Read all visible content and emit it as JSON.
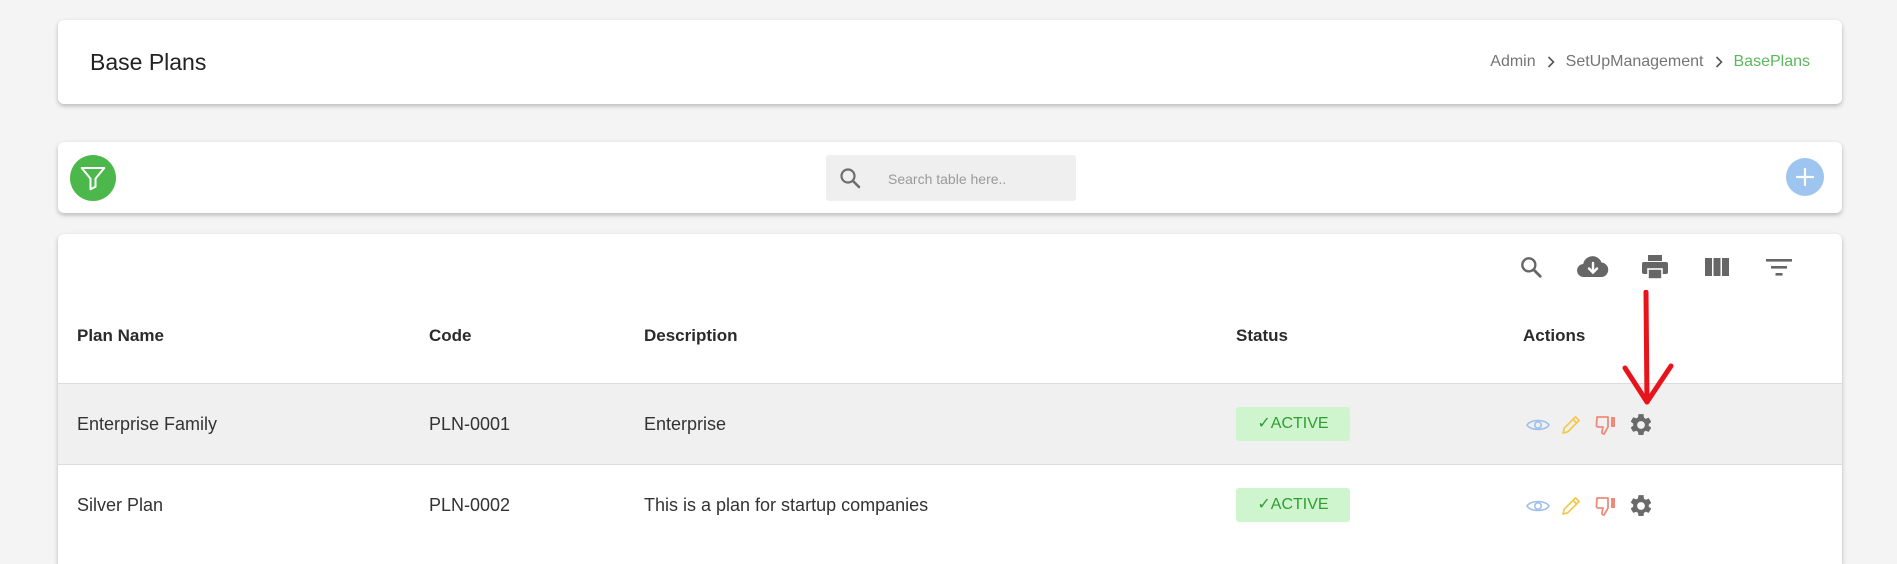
{
  "header": {
    "title": "Base Plans",
    "breadcrumb": [
      "Admin",
      "SetUpManagement",
      "BasePlans"
    ]
  },
  "toolbar": {
    "search_placeholder": "Search table here..",
    "search_value": "",
    "filter_icon": "filter-icon",
    "add_icon": "plus-icon"
  },
  "table_tools": [
    "search-icon",
    "cloud-download-icon",
    "print-icon",
    "view-columns-icon",
    "filter-list-icon"
  ],
  "table": {
    "columns": [
      "Plan Name",
      "Code",
      "Description",
      "Status",
      "Actions"
    ],
    "rows": [
      {
        "plan_name": "Enterprise Family",
        "code": "PLN-0001",
        "description": "Enterprise",
        "status": "✓ACTIVE"
      },
      {
        "plan_name": "Silver Plan",
        "code": "PLN-0002",
        "description": "This is a plan for startup companies",
        "status": "✓ACTIVE"
      }
    ],
    "row_actions": [
      "eye-icon",
      "pencil-icon",
      "thumbs-down-icon",
      "gear-icon"
    ]
  },
  "colors": {
    "accent_green": "#4cb84c",
    "breadcrumb_active": "#5cb85c",
    "status_badge_bg": "#cff5cf",
    "status_badge_text": "#2e9e2e",
    "add_button": "#9ec5ef",
    "annotation_arrow": "#e8141c"
  }
}
